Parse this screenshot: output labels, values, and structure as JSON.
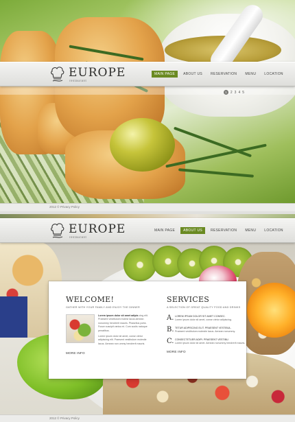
{
  "brand": {
    "name": "EUROPE",
    "tagline": "restaurant"
  },
  "slide1": {
    "nav": [
      {
        "label": "MAIN PAGE",
        "active": true
      },
      {
        "label": "ABOUT US",
        "active": false
      },
      {
        "label": "RESERVATION",
        "active": false
      },
      {
        "label": "MENU",
        "active": false
      },
      {
        "label": "LOCATION",
        "active": false
      }
    ],
    "pager": [
      "1",
      "2",
      "3",
      "4",
      "5"
    ],
    "footer": "2012 © Privacy Policy"
  },
  "slide2": {
    "nav": [
      {
        "label": "MAIN PAGE",
        "active": false
      },
      {
        "label": "ABOUT US",
        "active": true
      },
      {
        "label": "RESERVATION",
        "active": false
      },
      {
        "label": "MENU",
        "active": false
      },
      {
        "label": "LOCATION",
        "active": false
      }
    ],
    "footer": "2012 © Privacy Policy",
    "welcome": {
      "title": "WELCOME!",
      "subtitle": "GATHER WITH YOUR FAMILY AND ENJOY THE DINNER",
      "para1_lead": "Lorem ipsum dolor sit amet adipis",
      "para1": "cing elit. Praesent vestibulum molest lacus aenean nonummy hendrerit mauris. Phasellus porta. Fusce suscipit varius mi. Cum sociis natoque penatibus.",
      "para2": "Lorem ipsum dolor sit amet, conse ctetur adipiscing elit. Praesent vestibulum molestie lacus. Aenean non ummy hendrerit mauris.",
      "more": "MORE INFO"
    },
    "services": {
      "title": "SERVICES",
      "subtitle": "A SELECTION OF GREAT QUALITY FOOD AND DRINKS",
      "items": [
        {
          "letter": "A.",
          "head": "LOREM IPSUM DOLOR SIT AMET CONSEC.",
          "body": "Lorem ipsum dolor sit amet, conse ctetur adipiscing."
        },
        {
          "letter": "B.",
          "head": "TETUR ADIPISCING ELIT. PRAESENT VESTIBUL.",
          "body": "Praesent vestibulum molestie lacus. Aenean nonummy."
        },
        {
          "letter": "C.",
          "head": "CONSECTETUER ADIPI. PRAESENT VESTIBU.",
          "body": "Lorem ipsum dolor sit amet. Aenean nonummy hendrerit mauris."
        }
      ],
      "more": "MORE INFO"
    }
  },
  "colors": {
    "accent": "#6a8a22",
    "text": "#2e2e2c"
  }
}
